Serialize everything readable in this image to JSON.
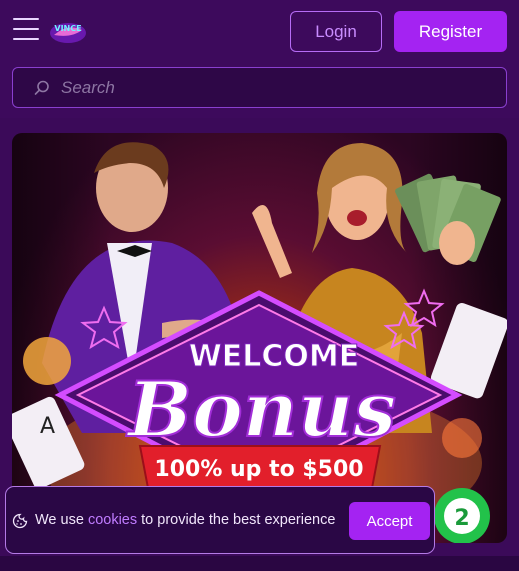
{
  "header": {
    "logo_text": "VINCE",
    "login_label": "Login",
    "register_label": "Register"
  },
  "search": {
    "placeholder": "Search",
    "icon": "search-icon"
  },
  "hero": {
    "line1": "WELCOME",
    "line2": "Bonus",
    "offer": "100% up to $500"
  },
  "cookie": {
    "text_before": "We use ",
    "link_text": "cookies",
    "text_after": " to provide the best experience",
    "accept_label": "Accept"
  },
  "colors": {
    "accent": "#a423f2",
    "background": "#3d0a5c",
    "link": "#c07cff"
  }
}
